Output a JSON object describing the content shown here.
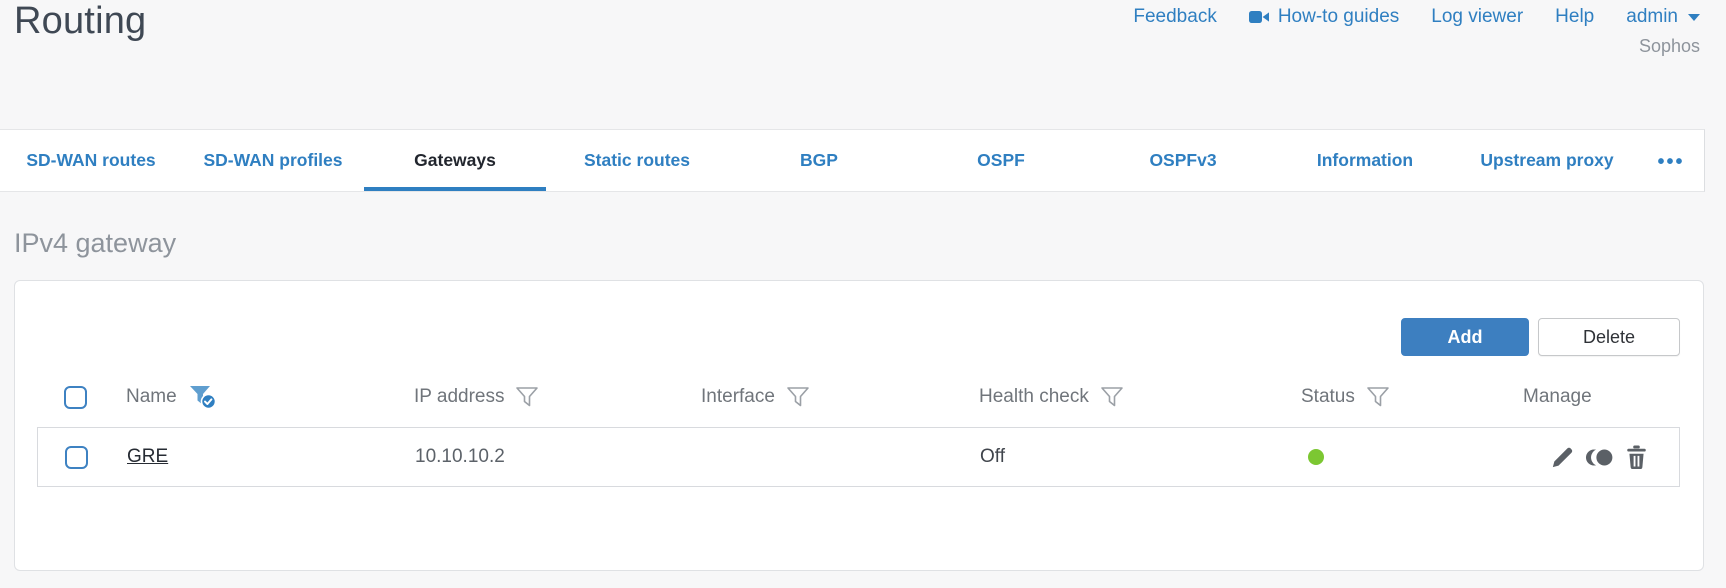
{
  "page": {
    "title": "Routing"
  },
  "header": {
    "links": [
      {
        "label": "Feedback"
      },
      {
        "label": "How-to guides",
        "icon": "video-camera"
      },
      {
        "label": "Log viewer"
      },
      {
        "label": "Help"
      }
    ],
    "user_menu": {
      "label": "admin",
      "icon": "chevron-down"
    },
    "brand": "Sophos"
  },
  "tabs": [
    {
      "label": "SD-WAN routes",
      "active": false
    },
    {
      "label": "SD-WAN profiles",
      "active": false
    },
    {
      "label": "Gateways",
      "active": true
    },
    {
      "label": "Static routes",
      "active": false
    },
    {
      "label": "BGP",
      "active": false
    },
    {
      "label": "OSPF",
      "active": false
    },
    {
      "label": "OSPFv3",
      "active": false
    },
    {
      "label": "Information",
      "active": false
    },
    {
      "label": "Upstream proxy",
      "active": false
    }
  ],
  "tabs_overflow": {
    "label": "•••",
    "icon": "ellipsis"
  },
  "section": {
    "heading": "IPv4 gateway"
  },
  "toolbar": {
    "add_label": "Add",
    "delete_label": "Delete"
  },
  "table": {
    "columns": [
      {
        "label": "",
        "type": "checkbox"
      },
      {
        "label": "Name",
        "filter": "active",
        "filter_icon": "funnel-check"
      },
      {
        "label": "IP address",
        "filter": "available",
        "filter_icon": "funnel"
      },
      {
        "label": "Interface",
        "filter": "available",
        "filter_icon": "funnel"
      },
      {
        "label": "Health check",
        "filter": "available",
        "filter_icon": "funnel"
      },
      {
        "label": "Status",
        "filter": "available",
        "filter_icon": "funnel"
      },
      {
        "label": "Manage",
        "filter": "none"
      }
    ],
    "rows": [
      {
        "name": "GRE",
        "ip_address": "10.10.10.2",
        "interface": "",
        "health_check": "Off",
        "status": "up",
        "actions": [
          "edit",
          "clone",
          "delete"
        ]
      }
    ]
  },
  "colors": {
    "accent_blue": "#2f7fc1",
    "button_blue": "#3d7fc0",
    "status_up_green": "#7cc732",
    "heading_gray": "#8e949c",
    "title_slate": "#3f4854",
    "background": "#f7f7f8"
  }
}
